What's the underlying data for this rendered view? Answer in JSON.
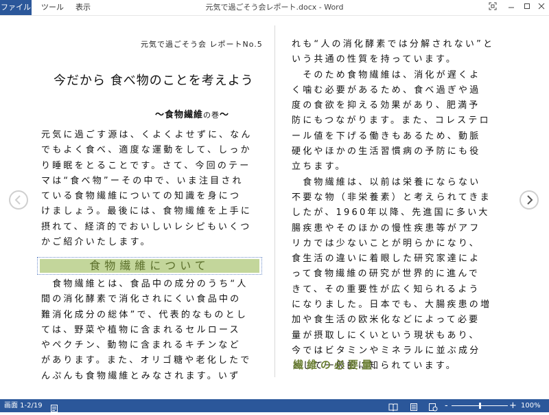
{
  "titlebar": {
    "menus": [
      "ファイル",
      "ツール",
      "表示"
    ],
    "doc_title": "元気で過ごそう会レポート.docx - Word"
  },
  "document": {
    "header_left": "元気で過ごそう会 レポートNo.5",
    "title": "今だから 食べ物のことを考えよう",
    "subtitle_prefix": "～食物繊維",
    "subtitle_small": "の巻",
    "subtitle_suffix": "～",
    "intro_lines": [
      "元気に過ごす源は、くよくよせずに、なん",
      "でもよく食べ、適度な運動をして、しっか",
      "り睡眠をとることです。さて、今回のテー",
      "マは“食べ物”ーその中で、いま注目され",
      "ている食物繊維についての知識を身につ",
      "けましょう。最後には、食物繊維を上手に",
      "摂れて、経済的でおいしいレシピもいくつ",
      "かご紹介いたします。"
    ],
    "section1_heading": "食物繊維について",
    "section1_lines": [
      "　食物繊維とは、食品中の成分のうち“人",
      "間の消化酵素で消化されにくい食品中の",
      "難消化成分の総体”で、代表的なものとし",
      "ては、野菜や植物に含まれるセルロース",
      "やペクチン、動物に含まれるキチンなど",
      "があります。また、オリゴ糖や老化したで",
      "んぷんも食物繊維とみなされます。いず"
    ],
    "right_lines": [
      "れも“人の消化酵素では分解されない”と",
      "いう共通の性質を持っています。",
      "　そのため食物繊維は、消化が遅くよ",
      "く噛む必要があるため、食べ過ぎや過",
      "度の食欲を抑える効果があり、肥満予",
      "防にもつながります。また、コレステロ",
      "ール値を下げる働きもあるため、動脈",
      "硬化やほかの生活習慣病の予防にも役",
      "立ちます。",
      "　食物繊維は、以前は栄養にならない",
      "不要な物（非栄養素）と考えられてきま",
      "したが、1960年以降、先進国に多い大",
      "腸疾患やそのほかの慢性疾患等がアフ",
      "リカでは少ないことが明らかになり、",
      "食生活の違いに着眼した研究家達によ",
      "って食物繊維の研究が世界的に進んで",
      "きて、その重要性が広く知られるよう",
      "になりました。日本でも、大腸疾患の増",
      "加や食生活の欧米化などによって必要",
      "量が摂取しにくいという現状もあり、",
      "今ではビタミンやミネラルに並ぶ成分",
      "として一般的に知られています。"
    ],
    "section2_heading": "繊維の必要量"
  },
  "statusbar": {
    "page_count": "画面 1-2/19",
    "zoom_minus": "-",
    "zoom_plus": "+",
    "zoom_level": "100%",
    "zoom_fraction": 0.5
  },
  "colors": {
    "accent": "#2b579a",
    "heading_bg": "#c3d69b",
    "heading_text": "#5a6e2a",
    "section2_text": "#6b7f34"
  },
  "icons": {
    "nav_prev": "chevron-left-icon",
    "nav_next": "chevron-right-icon",
    "fit": "fit-window-icon",
    "minimize": "minimize-icon",
    "maximize": "maximize-icon",
    "close": "close-icon"
  }
}
